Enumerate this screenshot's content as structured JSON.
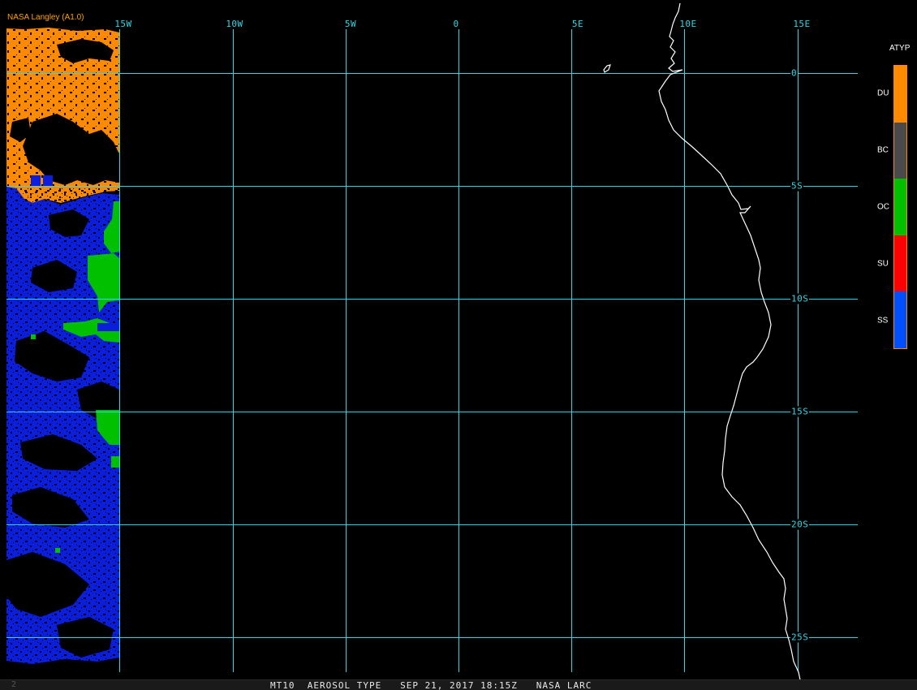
{
  "credit": "NASA Langley (A1.0)",
  "longitude_labels": [
    "15W",
    "10W",
    "5W",
    "0",
    "5E",
    "10E",
    "15E"
  ],
  "latitude_labels": [
    "0",
    "5S",
    "10S",
    "15S",
    "20S",
    "25S"
  ],
  "legend": {
    "title": "ATYP",
    "items": [
      {
        "label": "DU",
        "color": "#ff8a00"
      },
      {
        "label": "BC",
        "color": "#4a4a4a"
      },
      {
        "label": "OC",
        "color": "#00c000"
      },
      {
        "label": "SU",
        "color": "#ff0000"
      },
      {
        "label": "SS",
        "color": "#0050ff"
      }
    ]
  },
  "status_bar": {
    "left": "2",
    "text": "MT10  AEROSOL TYPE   SEP 21, 2017 18:15Z   NASA LARC"
  },
  "colors": {
    "grid": "#35d6e6",
    "coastline": "#ffffff",
    "background": "#000000"
  }
}
